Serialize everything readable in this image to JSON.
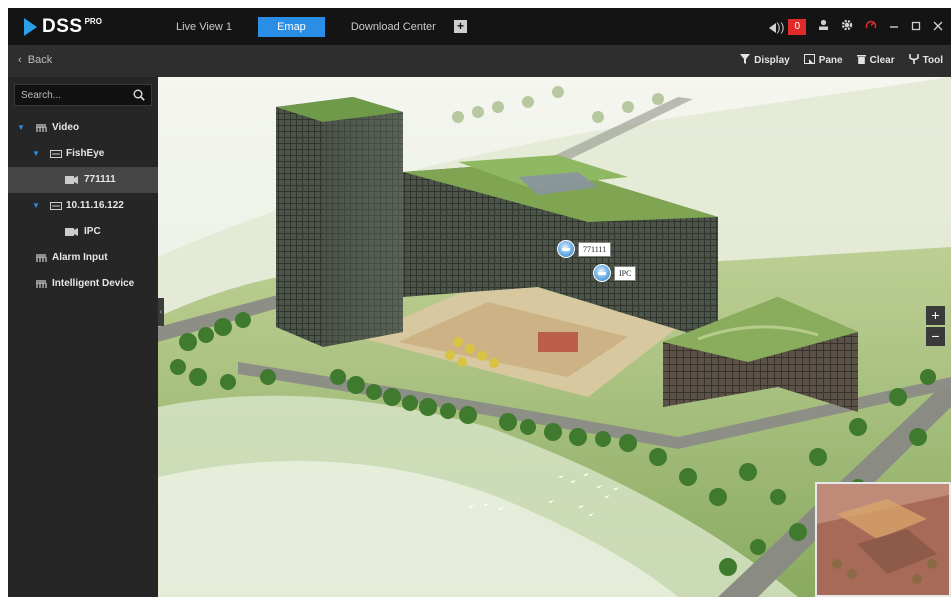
{
  "app": {
    "logo_text": "DSS",
    "logo_sup": "PRO"
  },
  "tabs": [
    {
      "label": "Live View 1",
      "active": false
    },
    {
      "label": "Emap",
      "active": true
    },
    {
      "label": "Download Center",
      "active": false
    }
  ],
  "top_right": {
    "alarm_count": "0",
    "icons": [
      "speaker-icon",
      "user-icon",
      "gear-icon",
      "gauge-icon",
      "minimize-icon",
      "maximize-icon",
      "close-icon"
    ]
  },
  "subbar": {
    "back_label": "Back",
    "tools": [
      {
        "label": "Display",
        "icon": "filter-icon"
      },
      {
        "label": "Pane",
        "icon": "pane-icon"
      },
      {
        "label": "Clear",
        "icon": "trash-icon"
      },
      {
        "label": "Tool",
        "icon": "tool-icon"
      }
    ]
  },
  "sidebar": {
    "search_placeholder": "Search...",
    "tree": [
      {
        "label": "Video",
        "level": 0,
        "expanded": true,
        "icon": "group-icon"
      },
      {
        "label": "FishEye",
        "level": 1,
        "expanded": true,
        "icon": "device-icon"
      },
      {
        "label": "771111",
        "level": 2,
        "selected": true,
        "icon": "camera-icon"
      },
      {
        "label": "10.11.16.122",
        "level": 1,
        "expanded": true,
        "icon": "device-icon"
      },
      {
        "label": "IPC",
        "level": 2,
        "icon": "camera-icon"
      },
      {
        "label": "Alarm Input",
        "level": 0,
        "icon": "group-icon"
      },
      {
        "label": "Intelligent Device",
        "level": 0,
        "icon": "group-icon"
      }
    ]
  },
  "map": {
    "cameras": [
      {
        "label": "771111"
      },
      {
        "label": "IPC"
      }
    ],
    "zoom_in": "+",
    "zoom_out": "−"
  },
  "colors": {
    "accent": "#2a8ee6",
    "alarm": "#e02b2b",
    "topbar": "#141414",
    "sidebar": "#262626"
  }
}
